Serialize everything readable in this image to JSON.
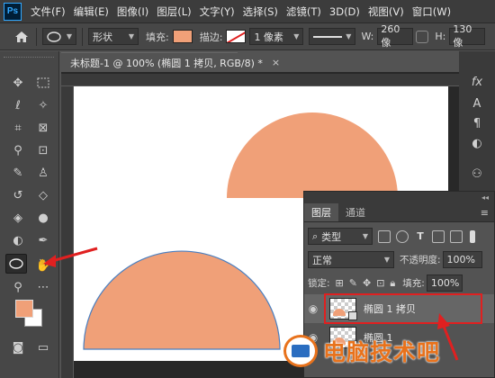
{
  "menubar": {
    "logo": "Ps",
    "items": [
      "文件(F)",
      "编辑(E)",
      "图像(I)",
      "图层(L)",
      "文字(Y)",
      "选择(S)",
      "滤镜(T)",
      "3D(D)",
      "视图(V)",
      "窗口(W)"
    ]
  },
  "options": {
    "mode": "形状",
    "fill_label": "填充:",
    "stroke_label": "描边:",
    "stroke_width": "1 像素",
    "w_label": "W:",
    "w_value": "260 像",
    "h_label": "H:",
    "h_value": "130 像"
  },
  "document": {
    "tab_title": "未标题-1 @ 100% (椭圆 1 拷贝, RGB/8) *",
    "tab_close": "×"
  },
  "tool_colors": {
    "foreground": "#f0a078",
    "background": "#ffffff"
  },
  "layers_panel": {
    "collapse": "◂◂",
    "tabs": [
      "图层",
      "通道"
    ],
    "filter_kind": "类型",
    "blend_mode": "正常",
    "opacity_label": "不透明度:",
    "opacity_value": "100%",
    "lock_label": "锁定:",
    "fill_label": "填充:",
    "fill_value": "100%",
    "layers": [
      {
        "name": "椭圆 1 拷贝",
        "selected": true
      },
      {
        "name": "椭圆 1",
        "selected": false
      }
    ]
  },
  "colors": {
    "shape_fill": "#f0a078",
    "shape_stroke": "#4a7fc0",
    "highlight": "#e02020"
  },
  "watermark": "电脑技术吧"
}
